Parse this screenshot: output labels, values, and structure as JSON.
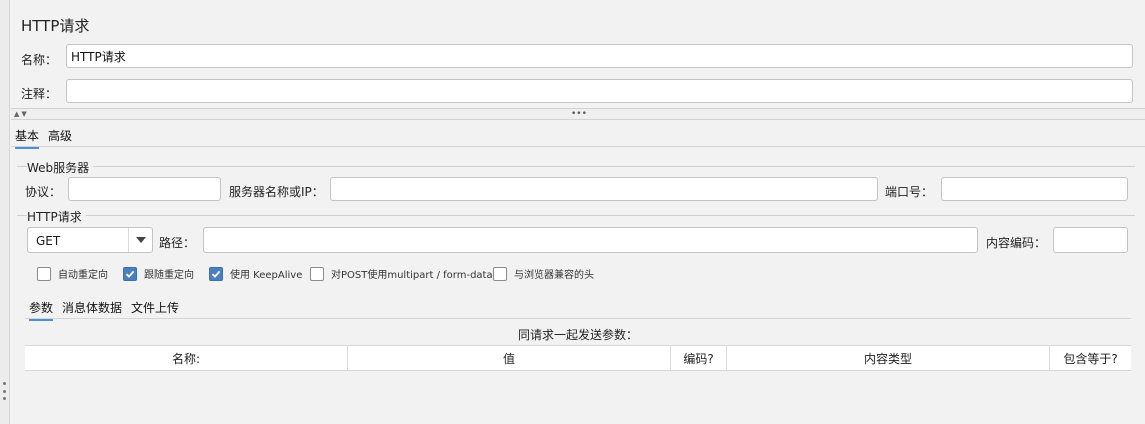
{
  "sampler": {
    "title": "HTTP请求",
    "name_label": "名称：",
    "name_value": "HTTP请求",
    "comment_label": "注释：",
    "comment_value": ""
  },
  "main_tabs": [
    {
      "label": "基本",
      "active": true
    },
    {
      "label": "高级",
      "active": false
    }
  ],
  "web_server": {
    "group_title": "Web服务器",
    "protocol_label": "协议：",
    "protocol_value": "",
    "server_label": "服务器名称或IP：",
    "server_value": "",
    "port_label": "端口号：",
    "port_value": ""
  },
  "http_request": {
    "group_title": "HTTP请求",
    "method": "GET",
    "path_label": "路径：",
    "path_value": "",
    "encoding_label": "内容编码：",
    "encoding_value": ""
  },
  "options": [
    {
      "label": "自动重定向",
      "checked": false
    },
    {
      "label": "跟随重定向",
      "checked": true
    },
    {
      "label": "使用 KeepAlive",
      "checked": true
    },
    {
      "label": "对POST使用multipart / form-data",
      "checked": false
    },
    {
      "label": "与浏览器兼容的头",
      "checked": false
    }
  ],
  "param_tabs": [
    {
      "label": "参数",
      "active": true
    },
    {
      "label": "消息体数据",
      "active": false
    },
    {
      "label": "文件上传",
      "active": false
    }
  ],
  "params_table": {
    "caption": "同请求一起发送参数：",
    "columns": [
      "名称:",
      "值",
      "编码?",
      "内容类型",
      "包含等于?"
    ]
  },
  "colors": {
    "accent": "#4a90d9",
    "checkbox_checked": "#4a7fc1",
    "background": "#f2f2f2"
  }
}
